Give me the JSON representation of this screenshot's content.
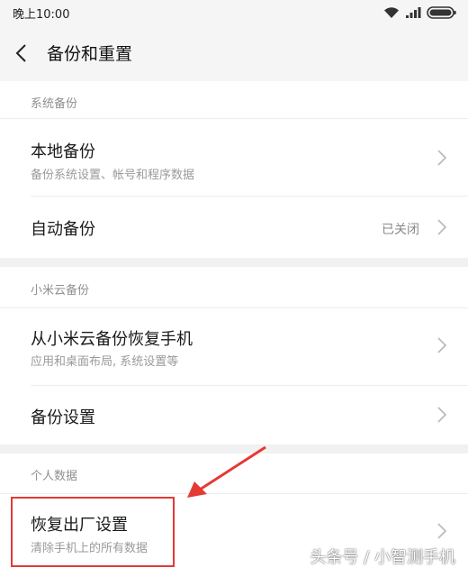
{
  "status_bar": {
    "time": "晚上10:00",
    "icons": [
      "wifi-icon",
      "signal-icon",
      "battery-icon"
    ]
  },
  "header": {
    "title": "备份和重置",
    "back_icon": "chevron-left-icon"
  },
  "sections": [
    {
      "label": "系统备份",
      "items": [
        {
          "title": "本地备份",
          "subtitle": "备份系统设置、帐号和程序数据"
        },
        {
          "title": "自动备份",
          "value": "已关闭"
        }
      ]
    },
    {
      "label": "小米云备份",
      "items": [
        {
          "title": "从小米云备份恢复手机",
          "subtitle": "应用和桌面布局, 系统设置等"
        },
        {
          "title": "备份设置"
        }
      ]
    },
    {
      "label": "个人数据",
      "items": [
        {
          "title": "恢复出厂设置",
          "subtitle": "清除手机上的所有数据"
        }
      ]
    }
  ],
  "annotation": {
    "highlight_color": "#e53935"
  },
  "watermark": "头条号 / 小智测手机",
  "colors": {
    "header_bg": "#f5f5f5",
    "section_gap": "#f1f1f1",
    "label_gray": "#8f8f8f"
  }
}
